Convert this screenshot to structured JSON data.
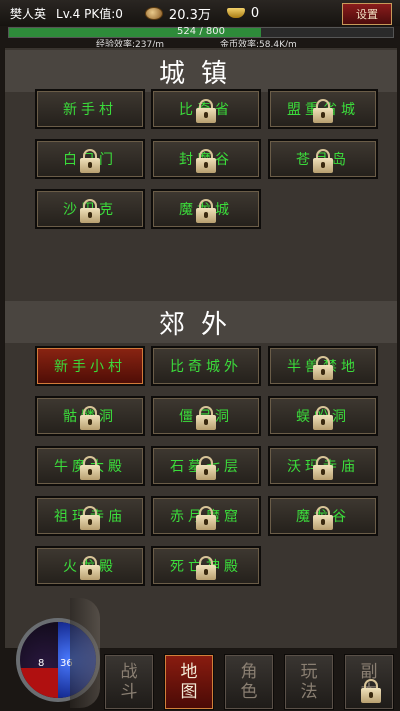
{
  "header": {
    "player_name": "樊人英",
    "level_pk": "Lv.4 PK值:0",
    "coins": "20.3万",
    "ingots": "0",
    "settings_label": "设置",
    "exp_text": "524 / 800",
    "exp_fraction": 0.655,
    "exp_rate": "经验效率:237/m",
    "gold_rate": "金币效率:58.4K/m"
  },
  "towns": {
    "title": "城镇",
    "items": [
      {
        "label": "新手村",
        "locked": false
      },
      {
        "label": "比奇省",
        "locked": true
      },
      {
        "label": "盟重省城",
        "locked": true
      },
      {
        "label": "白日门",
        "locked": true
      },
      {
        "label": "封魔谷",
        "locked": true
      },
      {
        "label": "苍月岛",
        "locked": true
      },
      {
        "label": "沙巴克",
        "locked": true
      },
      {
        "label": "魔龙城",
        "locked": true
      }
    ]
  },
  "outskirts": {
    "title": "郊外",
    "items": [
      {
        "label": "新手小村",
        "locked": false,
        "selected": true
      },
      {
        "label": "比奇城外",
        "locked": false
      },
      {
        "label": "半兽禁地",
        "locked": true
      },
      {
        "label": "骷髅洞",
        "locked": true
      },
      {
        "label": "僵尸洞",
        "locked": true
      },
      {
        "label": "蜈蚣洞",
        "locked": true
      },
      {
        "label": "牛魔大殿",
        "locked": true
      },
      {
        "label": "石墓七层",
        "locked": true
      },
      {
        "label": "沃玛寺庙",
        "locked": true
      },
      {
        "label": "祖玛寺庙",
        "locked": true
      },
      {
        "label": "赤月魔窟",
        "locked": true
      },
      {
        "label": "魔龙谷",
        "locked": true
      },
      {
        "label": "火龙殿",
        "locked": true
      },
      {
        "label": "死亡神殿",
        "locked": true
      }
    ]
  },
  "status": {
    "hp": "8",
    "mp": "36"
  },
  "nav": [
    {
      "top": "战",
      "bottom": "斗"
    },
    {
      "top": "地",
      "bottom": "图"
    },
    {
      "top": "角",
      "bottom": "色"
    },
    {
      "top": "玩",
      "bottom": "法"
    },
    {
      "top": "副",
      "bottom": "本"
    }
  ]
}
